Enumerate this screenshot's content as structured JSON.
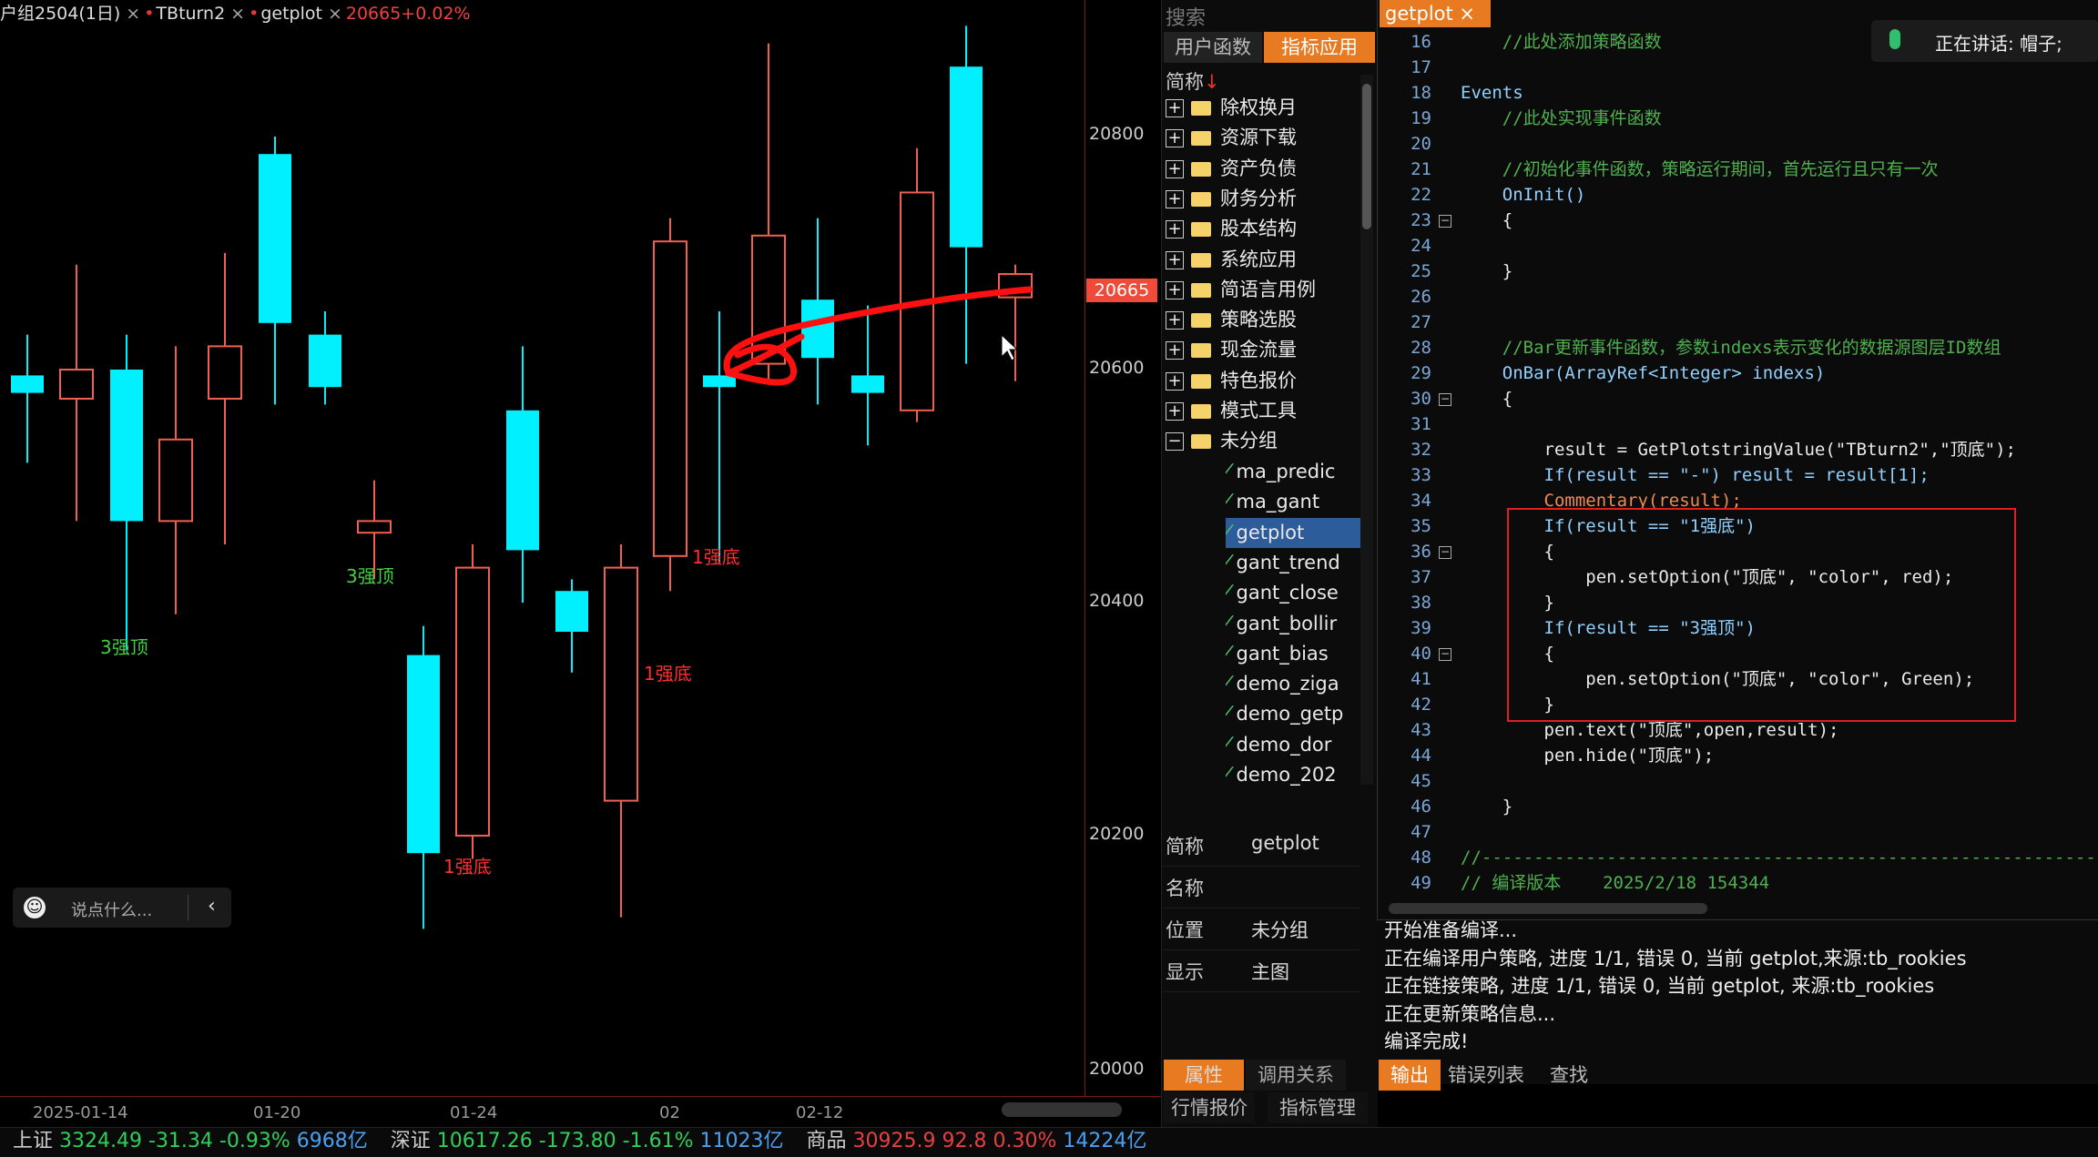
{
  "chart": {
    "title": {
      "symbol": "户组2504(1日)",
      "tab2": "TBturn2",
      "tab3": "getplot",
      "price": "20665+0.02%"
    },
    "price_tag": "20665",
    "yticks": [
      "20800",
      "20600",
      "20400",
      "20200",
      "20000"
    ],
    "xticks": [
      "2025-01-14",
      "01-20",
      "01-24",
      "02",
      "02-12"
    ],
    "chat_placeholder": "说点什么...",
    "labels": {
      "l1": "3强顶",
      "l2": "3强顶",
      "l3": "1强底",
      "l4": "1强底",
      "l5": "1强底"
    },
    "colors": {
      "up": "#f06050",
      "down": "#00f0ff",
      "label_green": "#3fd03f",
      "label_red": "#ff3030"
    }
  },
  "chart_data": {
    "type": "candlestick",
    "ylim": [
      20000,
      20900
    ],
    "candles": [
      {
        "o": 20595,
        "c": 20580,
        "h": 20630,
        "l": 20520
      },
      {
        "o": 20575,
        "c": 20600,
        "h": 20690,
        "l": 20470
      },
      {
        "o": 20600,
        "c": 20470,
        "h": 20630,
        "l": 20360
      },
      {
        "o": 20470,
        "c": 20540,
        "h": 20620,
        "l": 20390
      },
      {
        "o": 20575,
        "c": 20620,
        "h": 20700,
        "l": 20450
      },
      {
        "o": 20785,
        "c": 20640,
        "h": 20800,
        "l": 20570
      },
      {
        "o": 20630,
        "c": 20585,
        "h": 20650,
        "l": 20570
      },
      {
        "o": 20460,
        "c": 20470,
        "h": 20505,
        "l": 20420
      },
      {
        "o": 20355,
        "c": 20185,
        "h": 20380,
        "l": 20120
      },
      {
        "o": 20200,
        "c": 20430,
        "h": 20450,
        "l": 20180
      },
      {
        "o": 20565,
        "c": 20445,
        "h": 20620,
        "l": 20400
      },
      {
        "o": 20410,
        "c": 20375,
        "h": 20420,
        "l": 20340
      },
      {
        "o": 20230,
        "c": 20430,
        "h": 20450,
        "l": 20130
      },
      {
        "o": 20440,
        "c": 20710,
        "h": 20730,
        "l": 20410
      },
      {
        "o": 20595,
        "c": 20585,
        "h": 20650,
        "l": 20435
      },
      {
        "o": 20605,
        "c": 20715,
        "h": 20880,
        "l": 20590
      },
      {
        "o": 20660,
        "c": 20610,
        "h": 20730,
        "l": 20570
      },
      {
        "o": 20595,
        "c": 20580,
        "h": 20655,
        "l": 20535
      },
      {
        "o": 20565,
        "c": 20752,
        "h": 20790,
        "l": 20555
      },
      {
        "o": 20860,
        "c": 20705,
        "h": 20895,
        "l": 20605
      },
      {
        "o": 20662,
        "c": 20682,
        "h": 20690,
        "l": 20590
      }
    ]
  },
  "panel": {
    "search": "搜索",
    "tab_user": "用户函数",
    "tab_indicator": "指标应用",
    "header": "简称",
    "header_arrow": "↓",
    "folders": [
      "除权换月",
      "资源下载",
      "资产负债",
      "财务分析",
      "股本结构",
      "系统应用",
      "简语言用例",
      "策略选股",
      "现金流量",
      "特色报价",
      "模式工具",
      "未分组"
    ],
    "children": [
      "ma_predic",
      "ma_gant",
      "getplot",
      "gant_trend",
      "gant_close",
      "gant_bollir",
      "gant_bias",
      "demo_ziga",
      "demo_getp",
      "demo_dor",
      "demo_202"
    ],
    "props": [
      {
        "k": "简称",
        "v": "getplot"
      },
      {
        "k": "名称",
        "v": ""
      },
      {
        "k": "位置",
        "v": "未分组"
      },
      {
        "k": "显示",
        "v": "主图"
      }
    ],
    "btab_prop": "属性",
    "btab_call": "调用关系",
    "btab_quote": "行情报价",
    "btab_mgr": "指标管理"
  },
  "editor": {
    "tab": "getplot ×",
    "mic_text": "正在讲话:  帽子;",
    "lines": [
      {
        "n": "16",
        "t": "    //此处添加策略函数"
      },
      {
        "n": "17",
        "t": ""
      },
      {
        "n": "18",
        "t": "Events"
      },
      {
        "n": "19",
        "t": "    //此处实现事件函数"
      },
      {
        "n": "20",
        "t": ""
      },
      {
        "n": "21",
        "t": "    //初始化事件函数，策略运行期间，首先运行且只有一次"
      },
      {
        "n": "22",
        "t": "    OnInit()"
      },
      {
        "n": "23",
        "t": "    {"
      },
      {
        "n": "24",
        "t": ""
      },
      {
        "n": "25",
        "t": "    }"
      },
      {
        "n": "26",
        "t": ""
      },
      {
        "n": "27",
        "t": ""
      },
      {
        "n": "28",
        "t": "    //Bar更新事件函数，参数indexs表示变化的数据源图层ID数组"
      },
      {
        "n": "29",
        "t": "    OnBar(ArrayRef<Integer> indexs)"
      },
      {
        "n": "30",
        "t": "    {"
      },
      {
        "n": "31",
        "t": ""
      },
      {
        "n": "32",
        "t": "        result = GetPlotstringValue(\"TBturn2\",\"顶底\");"
      },
      {
        "n": "33",
        "t": "        If(result == \"-\") result = result[1];"
      },
      {
        "n": "34",
        "t": "        Commentary(result);"
      },
      {
        "n": "35",
        "t": "        If(result == \"1强底\")"
      },
      {
        "n": "36",
        "t": "        {"
      },
      {
        "n": "37",
        "t": "            pen.setOption(\"顶底\", \"color\", red);"
      },
      {
        "n": "38",
        "t": "        }"
      },
      {
        "n": "39",
        "t": "        If(result == \"3强顶\")"
      },
      {
        "n": "40",
        "t": "        {"
      },
      {
        "n": "41",
        "t": "            pen.setOption(\"顶底\", \"color\", Green);"
      },
      {
        "n": "42",
        "t": "        }"
      },
      {
        "n": "43",
        "t": "        pen.text(\"顶底\",open,result);"
      },
      {
        "n": "44",
        "t": "        pen.hide(\"顶底\");"
      },
      {
        "n": "45",
        "t": ""
      },
      {
        "n": "46",
        "t": "    }"
      },
      {
        "n": "47",
        "t": ""
      },
      {
        "n": "48",
        "t": "//-----------------------------------------------------------"
      },
      {
        "n": "49",
        "t": "// 编译版本    2025/2/18 154344"
      }
    ]
  },
  "output": {
    "lines": [
      "开始准备编译...",
      "正在编译用户策略, 进度 1/1, 错误 0, 当前 getplot,来源:tb_rookies",
      "正在链接策略, 进度 1/1, 错误 0, 当前 getplot, 来源:tb_rookies",
      "正在更新策略信息...",
      "编译完成!"
    ],
    "tab_output": "输出",
    "tab_errors": "错误列表",
    "tab_find": "查找"
  },
  "status": {
    "sh_label": "上证",
    "sh_val": "3324.49",
    "sh_chg": "-31.34",
    "sh_pct": "-0.93%",
    "sh_amt": "6968亿",
    "sz_label": "深证",
    "sz_val": "10617.26",
    "sz_chg": "-173.80",
    "sz_pct": "-1.61%",
    "sz_amt": "11023亿",
    "cm_label": "商品",
    "cm_val": "30925.9",
    "cm_chg": "92.8",
    "cm_pct": "0.30%",
    "cm_amt": "14224亿"
  }
}
